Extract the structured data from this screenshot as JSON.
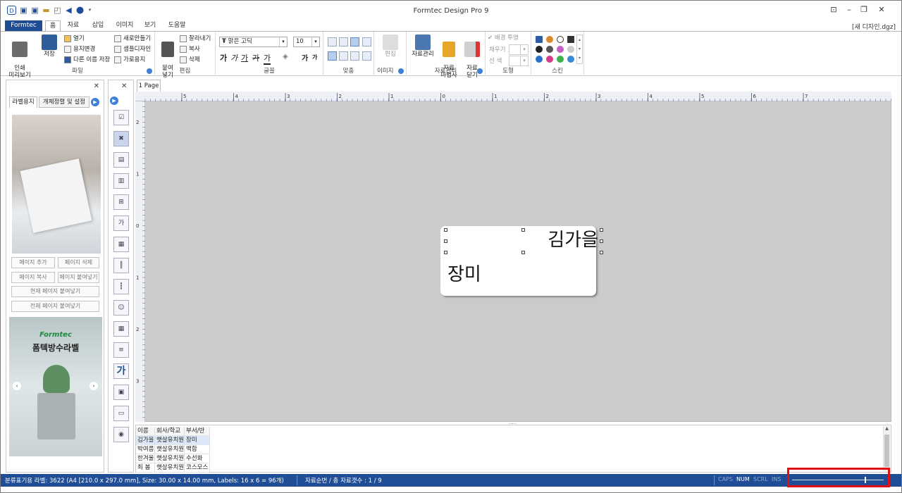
{
  "app": {
    "title": "Formtec Design Pro 9",
    "filename": "[새 디자인.dgz]"
  },
  "tabs": [
    "Formtec",
    "홈",
    "자료",
    "삽입",
    "이미지",
    "보기",
    "도움말"
  ],
  "ribbon": {
    "file": {
      "label": "파일",
      "print_preview": "인쇄\n미리보기",
      "save": "저장",
      "open": "열기",
      "change_paper": "용지변경",
      "save_as": "다른 이름 저장",
      "new": "새로만들기",
      "sample": "샘플디자인",
      "landscape": "가로용지"
    },
    "edit": {
      "label": "편집",
      "paste": "붙여\n넣기",
      "cut": "잘라내기",
      "copy": "복사",
      "delete": "삭제"
    },
    "font": {
      "label": "글꼴",
      "font_name": "맑은 고딕",
      "font_size": "10"
    },
    "align": {
      "label": "맞춤"
    },
    "image": {
      "label": "이미지",
      "edit": "편집"
    },
    "data": {
      "label": "자료관리",
      "manage": "자료관리",
      "wizard": "자료\n마법사",
      "close": "자료\n닫기"
    },
    "shape": {
      "label": "도형",
      "transparent": "배경 투명",
      "fill": "채우기",
      "line": "선 색"
    },
    "skin": {
      "label": "스킨"
    }
  },
  "left_panel": {
    "tabs": [
      "라벨용지",
      "개체정렬 및 설정"
    ],
    "buttons": [
      "페이지 추가",
      "페이지 삭제",
      "페이지 복사",
      "페이지 붙여넣기",
      "현재 페이지 붙여넣기",
      "전체 페이지 붙여넣기"
    ],
    "ad_brand": "Formtec",
    "ad_title": "폼텍방수라벨"
  },
  "page_tab": "1 Page",
  "label": {
    "text1": "김가을",
    "text2": "장미"
  },
  "ruler_h": [
    "5",
    "4",
    "3",
    "2",
    "1",
    "0",
    "1",
    "2",
    "3",
    "4",
    "5",
    "6",
    "7"
  ],
  "ruler_v": [
    "2",
    "1",
    "0",
    "1",
    "2",
    "3"
  ],
  "grid": {
    "headers": [
      "이름",
      "회사/학교",
      "부서/반"
    ],
    "rows": [
      [
        "김가을",
        "햇살유치원",
        "장미"
      ],
      [
        "박여름",
        "햇살유치원",
        "백합"
      ],
      [
        "한겨울",
        "햇살유치원",
        "수선화"
      ],
      [
        "최 봄",
        "햇살유치원",
        "코스모스"
      ]
    ]
  },
  "status": {
    "info": "분류표기용 라벨: 3622 (A4 [210.0 x 297.0 mm], Size: 30.00 x 14.00 mm,  Labels: 16 x 6 = 96개)",
    "record": "자료순번 / 총 자료갯수 : 1 / 9",
    "caps": "CAPS",
    "num": "NUM",
    "scrl": "SCRL",
    "ins": "INS"
  }
}
